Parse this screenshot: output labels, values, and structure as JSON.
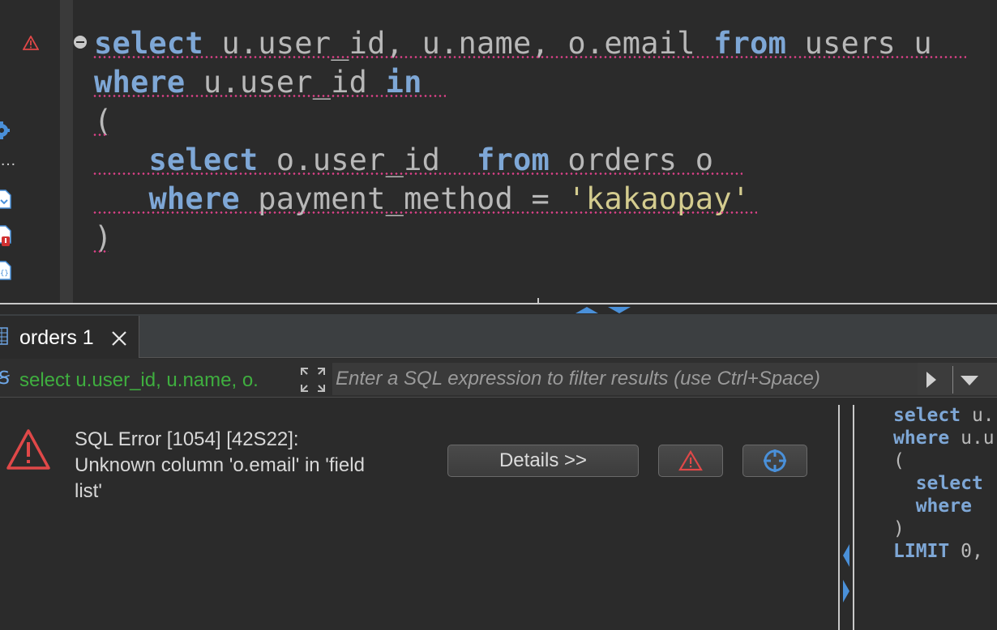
{
  "editor": {
    "lines": [
      {
        "parts": [
          {
            "t": "select",
            "c": "kw"
          },
          {
            "t": " u.user_id, u.name, o.email ",
            "c": ""
          },
          {
            "t": "from",
            "c": "kw"
          },
          {
            "t": " users u",
            "c": ""
          }
        ]
      },
      {
        "parts": [
          {
            "t": "where",
            "c": "kw"
          },
          {
            "t": " u.user_id ",
            "c": ""
          },
          {
            "t": "in",
            "c": "kw"
          }
        ]
      },
      {
        "parts": [
          {
            "t": "(",
            "c": ""
          }
        ]
      },
      {
        "parts": [
          {
            "t": "   ",
            "c": ""
          },
          {
            "t": "select",
            "c": "kw"
          },
          {
            "t": " o.user_id  ",
            "c": ""
          },
          {
            "t": "from",
            "c": "kw"
          },
          {
            "t": " orders o",
            "c": ""
          }
        ]
      },
      {
        "parts": [
          {
            "t": "   ",
            "c": ""
          },
          {
            "t": "where",
            "c": "kw"
          },
          {
            "t": " payment_method = ",
            "c": ""
          },
          {
            "t": "'kakaopay'",
            "c": "str"
          }
        ]
      },
      {
        "parts": [
          {
            "t": ")",
            "c": ""
          }
        ]
      }
    ]
  },
  "results": {
    "tab_label": "orders 1",
    "filter_query": "select u.user_id, u.name, o.",
    "filter_placeholder": "Enter a SQL expression to filter results (use Ctrl+Space)"
  },
  "error": {
    "line1": "SQL Error [1054] [42S22]:",
    "line2": "Unknown column 'o.email' in 'field",
    "line3": "list'",
    "details_label": "Details >>"
  },
  "preview": {
    "lines": [
      {
        "parts": [
          {
            "t": "select",
            "c": "kw"
          },
          {
            "t": " u.",
            "c": ""
          }
        ]
      },
      {
        "parts": [
          {
            "t": "where",
            "c": "kw"
          },
          {
            "t": " u.u",
            "c": ""
          }
        ]
      },
      {
        "parts": [
          {
            "t": "(",
            "c": ""
          }
        ]
      },
      {
        "parts": [
          {
            "t": "  ",
            "c": ""
          },
          {
            "t": "select",
            "c": "kw"
          }
        ]
      },
      {
        "parts": [
          {
            "t": "  ",
            "c": ""
          },
          {
            "t": "where",
            "c": "kw"
          }
        ]
      },
      {
        "parts": [
          {
            "t": ")",
            "c": ""
          }
        ]
      },
      {
        "parts": [
          {
            "t": "LIMIT",
            "c": "kw"
          },
          {
            "t": " 0,",
            "c": ""
          }
        ]
      }
    ]
  },
  "colors": {
    "keyword": "#7ea7d6",
    "string": "#d4cc8f",
    "error": "#e04848",
    "success_text": "#3fae3f"
  },
  "icons": [
    "warning-icon",
    "settings-icon",
    "more-icon",
    "script-icon",
    "script-error-icon",
    "script-json-icon",
    "collapse-icon",
    "grid-icon",
    "close-icon",
    "sql-icon",
    "expand-icon",
    "run-filter-icon",
    "dropdown-icon",
    "error-icon",
    "crosshair-icon"
  ]
}
